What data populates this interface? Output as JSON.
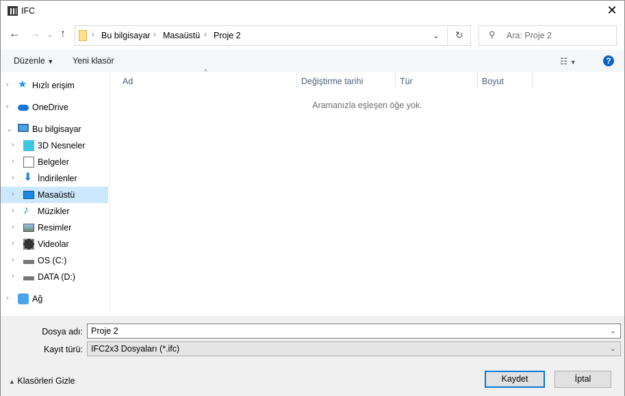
{
  "window": {
    "title": "IFC",
    "close": "✕"
  },
  "address": {
    "crumbs": [
      "Bu bilgisayar",
      "Masaüstü",
      "Proje 2"
    ],
    "search_placeholder": "Ara: Proje 2"
  },
  "toolbar": {
    "organize": "Düzenle",
    "new_folder": "Yeni klasör",
    "help": "?"
  },
  "nav": [
    {
      "label": "Hızlı erişim",
      "icon": "star-icon",
      "level": 0,
      "expanded": false
    },
    {
      "label": "OneDrive",
      "icon": "cloud-icon",
      "level": 0,
      "expanded": false
    },
    {
      "label": "Bu bilgisayar",
      "icon": "computer-icon",
      "level": 0,
      "expanded": true
    },
    {
      "label": "3D Nesneler",
      "icon": "cube-icon",
      "level": 1
    },
    {
      "label": "Belgeler",
      "icon": "document-icon",
      "level": 1
    },
    {
      "label": "İndirilenler",
      "icon": "download-icon",
      "level": 1
    },
    {
      "label": "Masaüstü",
      "icon": "desktop-icon",
      "level": 1,
      "selected": true
    },
    {
      "label": "Müzikler",
      "icon": "music-icon",
      "level": 1
    },
    {
      "label": "Resimler",
      "icon": "picture-icon",
      "level": 1
    },
    {
      "label": "Videolar",
      "icon": "video-icon",
      "level": 1
    },
    {
      "label": "OS (C:)",
      "icon": "drive-icon",
      "level": 1
    },
    {
      "label": "DATA (D:)",
      "icon": "drive-icon",
      "level": 1
    },
    {
      "label": "Ağ",
      "icon": "network-icon",
      "level": 0,
      "expanded": false
    }
  ],
  "columns": [
    "Ad",
    "Değiştirme tarihi",
    "Tür",
    "Boyut"
  ],
  "empty_message": "Aramanızla eşleşen öğe yok.",
  "form": {
    "filename_label": "Dosya adı:",
    "filename_value": "Proje 2",
    "type_label": "Kayıt türü:",
    "type_value": "IFC2x3 Dosyaları (*.ifc)"
  },
  "footer": {
    "hide_folders": "Klasörleri Gizle",
    "save": "Kaydet",
    "cancel": "İptal"
  }
}
